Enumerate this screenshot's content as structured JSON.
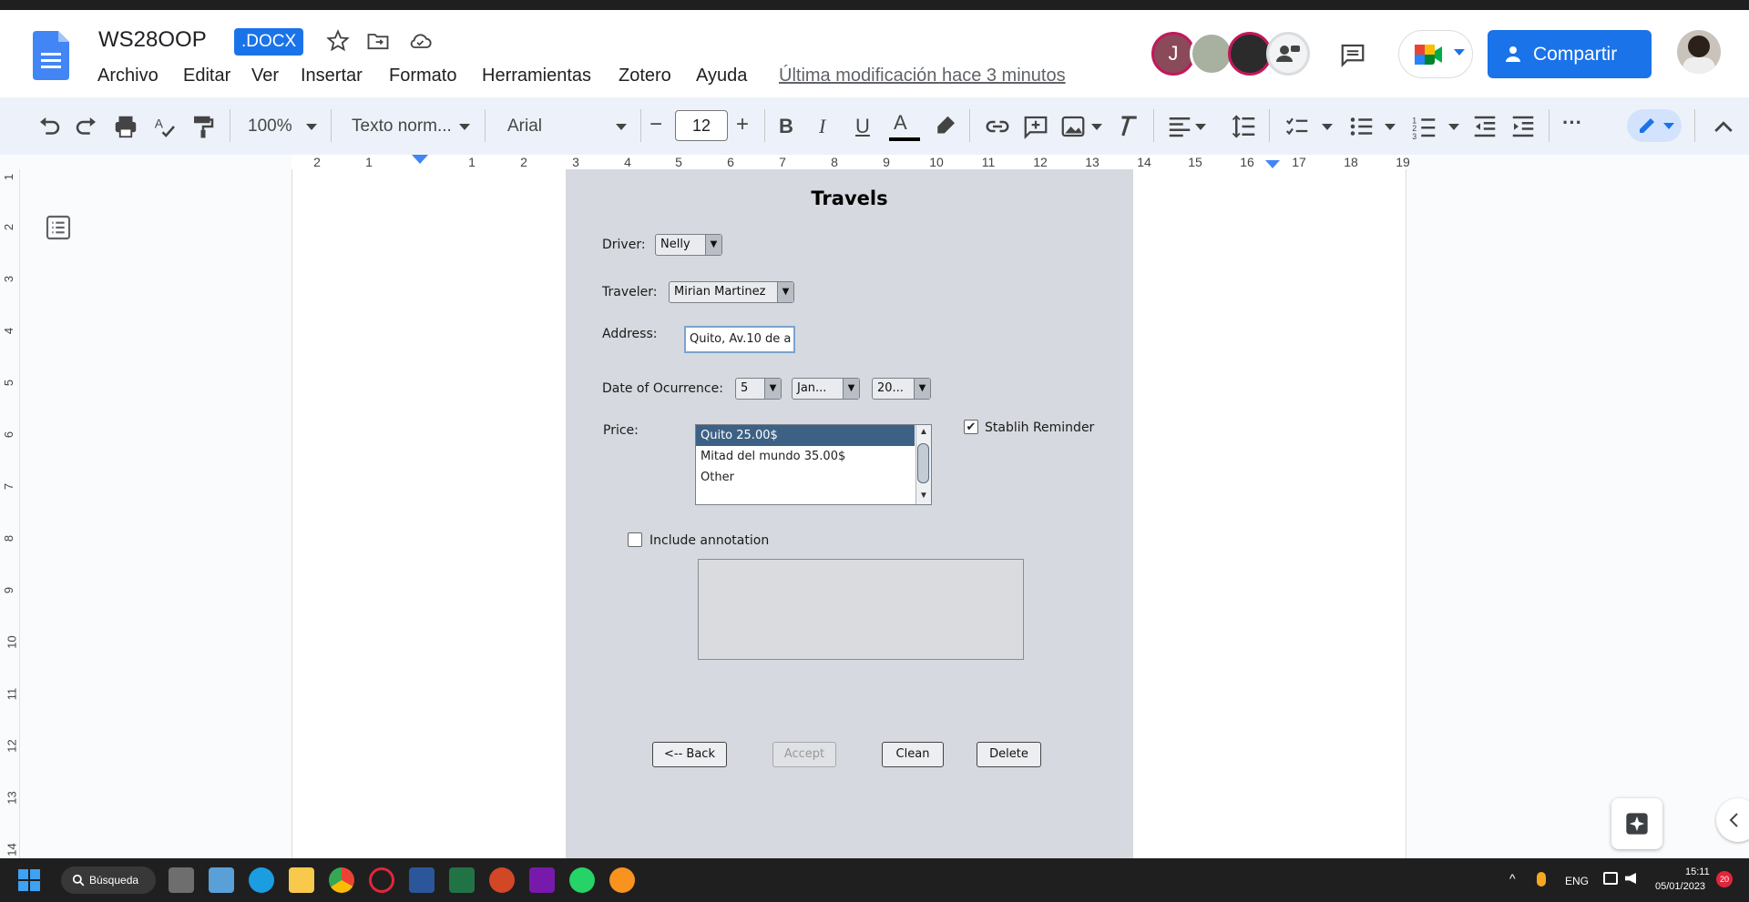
{
  "doc": {
    "title": "WS28OOP",
    "badge": ".DOCX",
    "last_modified": "Última modificación hace 3 minutos"
  },
  "menu": [
    "Archivo",
    "Editar",
    "Ver",
    "Insertar",
    "Formato",
    "Herramientas",
    "Zotero",
    "Ayuda"
  ],
  "share_label": "Compartir",
  "avatar_initial": "J",
  "toolbar": {
    "zoom": "100%",
    "style": "Texto norm...",
    "font": "Arial",
    "font_size": "12"
  },
  "ruler": [
    "2",
    "1",
    "1",
    "2",
    "3",
    "4",
    "5",
    "6",
    "7",
    "8",
    "9",
    "10",
    "11",
    "12",
    "13",
    "14",
    "15",
    "16",
    "17",
    "18",
    "19"
  ],
  "vruler": [
    "1",
    "2",
    "3",
    "4",
    "5",
    "6",
    "7",
    "8",
    "9",
    "10",
    "11",
    "12",
    "13",
    "14"
  ],
  "form": {
    "title": "Travels",
    "driver_label": "Driver:",
    "driver_value": "Nelly",
    "traveler_label": "Traveler:",
    "traveler_value": "Mirian Martinez",
    "address_label": "Address:",
    "address_value": "Quito, Av.10 de a",
    "date_label": "Date of Ocurrence:",
    "day": "5",
    "month": "Jan...",
    "year": "20...",
    "price_label": "Price:",
    "price_options": [
      "Quito 25.00$",
      "Mitad del mundo 35.00$",
      "Other"
    ],
    "reminder_label": "Stablih Reminder",
    "reminder_checked": true,
    "annotation_label": "Include annotation",
    "annotation_checked": false,
    "buttons": {
      "back": "<-- Back",
      "accept": "Accept",
      "clean": "Clean",
      "delete": "Delete"
    }
  },
  "taskbar": {
    "search": "Búsqueda",
    "lang": "ENG",
    "time": "15:11",
    "date": "05/01/2023",
    "notif": "20"
  },
  "colors": {
    "accent": "#1a73e8",
    "panel": "#d6d9df",
    "selected": "#3d6185"
  }
}
